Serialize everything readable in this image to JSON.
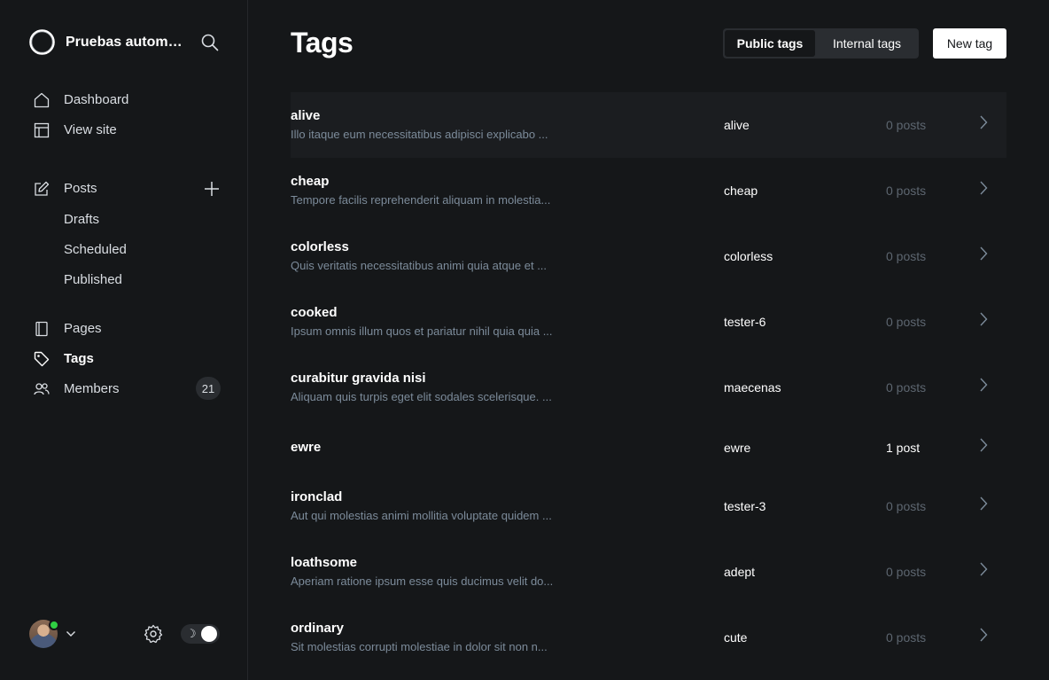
{
  "sidebar": {
    "site_title": "Pruebas automatizadas",
    "nav": {
      "dashboard": "Dashboard",
      "view_site": "View site",
      "posts": "Posts",
      "drafts": "Drafts",
      "scheduled": "Scheduled",
      "published": "Published",
      "pages": "Pages",
      "tags": "Tags",
      "members": "Members",
      "members_count": "21"
    },
    "theme_toggle_icon": "moon-icon"
  },
  "header": {
    "title": "Tags",
    "filter_public": "Public tags",
    "filter_internal": "Internal tags",
    "new_tag": "New tag"
  },
  "tags": [
    {
      "name": "alive",
      "description": "Illo itaque eum necessitatibus adipisci explicabo ...",
      "slug": "alive",
      "count": "0 posts"
    },
    {
      "name": "cheap",
      "description": "Tempore facilis reprehenderit aliquam in molestia...",
      "slug": "cheap",
      "count": "0 posts"
    },
    {
      "name": "colorless",
      "description": "Quis veritatis necessitatibus animi quia atque et ...",
      "slug": "colorless",
      "count": "0 posts"
    },
    {
      "name": "cooked",
      "description": "Ipsum omnis illum quos et pariatur nihil quia quia ...",
      "slug": "tester-6",
      "count": "0 posts"
    },
    {
      "name": "curabitur gravida nisi",
      "description": "Aliquam quis turpis eget elit sodales scelerisque. ...",
      "slug": "maecenas",
      "count": "0 posts"
    },
    {
      "name": "ewre",
      "description": "",
      "slug": "ewre",
      "count": "1 post"
    },
    {
      "name": "ironclad",
      "description": "Aut qui molestias animi mollitia voluptate quidem ...",
      "slug": "tester-3",
      "count": "0 posts"
    },
    {
      "name": "loathsome",
      "description": "Aperiam ratione ipsum esse quis ducimus velit do...",
      "slug": "adept",
      "count": "0 posts"
    },
    {
      "name": "ordinary",
      "description": "Sit molestias corrupti molestiae in dolor sit non n...",
      "slug": "cute",
      "count": "0 posts"
    }
  ]
}
